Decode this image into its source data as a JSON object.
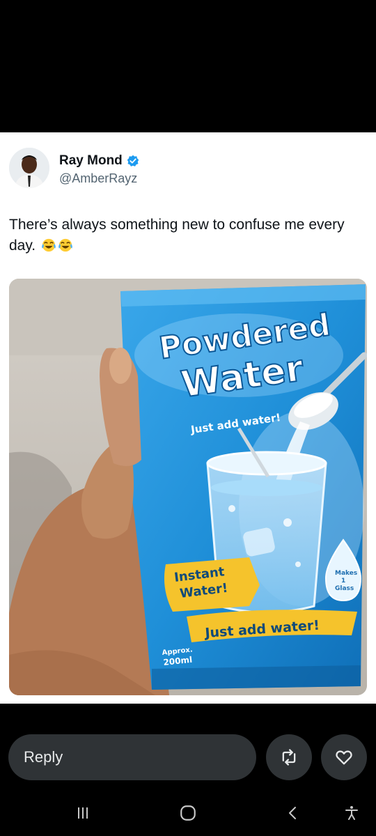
{
  "tweet": {
    "display_name": "Ray Mond",
    "handle": "@AmberRayz",
    "text": "There’s always something new to confuse me every day.",
    "emoji": "face-with-tears-of-joy",
    "verified": true
  },
  "media": {
    "package_title_line1": "Powdered",
    "package_title_line2": "Water",
    "tagline_top": "Just add water!",
    "badge_left_line1": "Instant",
    "badge_left_line2": "Water!",
    "drop_badge_line1": "Makes",
    "drop_badge_line2": "1",
    "drop_badge_line3": "Glass",
    "banner_bottom": "Just add water!",
    "volume_line1": "Approx.",
    "volume_line2": "200ml"
  },
  "actions": {
    "reply_label": "Reply",
    "retweet_icon": "retweet-icon",
    "like_icon": "heart-icon"
  },
  "nav": {
    "recents_icon": "recents-icon",
    "home_icon": "home-icon",
    "back_icon": "back-icon",
    "accessibility_icon": "accessibility-icon"
  },
  "colors": {
    "verified_blue": "#1d9bf0",
    "package_blue": "#1f8fd8",
    "banner_yellow": "#f5c32c",
    "dark_button": "#2f3336"
  }
}
